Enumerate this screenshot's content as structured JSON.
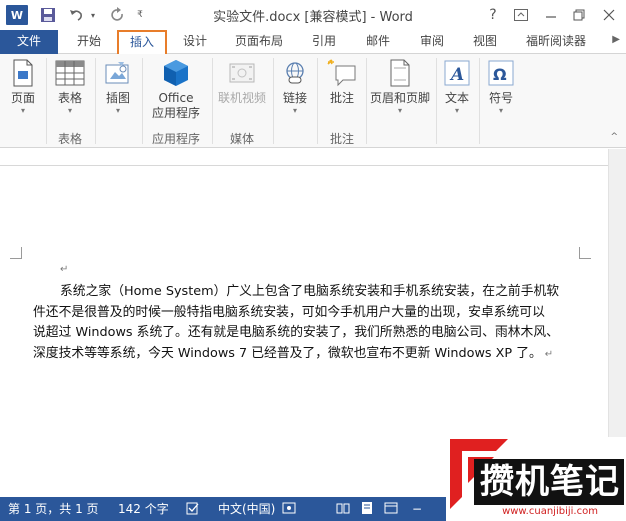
{
  "window": {
    "app_icon_letter": "W",
    "title": "实验文件.docx [兼容模式] - Word",
    "help_label": "?"
  },
  "tabs": [
    {
      "label": "文件"
    },
    {
      "label": "开始"
    },
    {
      "label": "插入"
    },
    {
      "label": "设计"
    },
    {
      "label": "页面布局"
    },
    {
      "label": "引用"
    },
    {
      "label": "邮件"
    },
    {
      "label": "审阅"
    },
    {
      "label": "视图"
    },
    {
      "label": "福昕阅读器"
    }
  ],
  "ribbon": {
    "page_label": "页面",
    "table_label": "表格",
    "illustrations_label": "插图",
    "office_line1": "Office",
    "office_line2": "应用程序",
    "online_video_label": "联机视频",
    "link_label": "链接",
    "comment_label": "批注",
    "header_footer_label": "页眉和页脚",
    "text_label": "文本",
    "symbol_label": "符号",
    "groups": {
      "tables": "表格",
      "apps": "应用程序",
      "media": "媒体",
      "comments": "批注"
    }
  },
  "document": {
    "lines": [
      "系统之家（Home System）广义上包含了电脑系统安装和手机系统安装，在之前手机软",
      "件还不是很普及的时候一般特指电脑系统安装，可如今手机用户大量的出现，安卓系统可以",
      "说超过 Windows 系统了。还有就是电脑系统的安装了，我们所熟悉的电脑公司、雨林木风、",
      "深度技术等等系统，今天 Windows 7 已经普及了，微软也宣布不更新 Windows XP 了。"
    ],
    "para_mark": "↵"
  },
  "status": {
    "page": "第 1 页，共 1 页",
    "words": "142 个字",
    "language": "中文(中国)"
  },
  "watermark": {
    "title": "攒机笔记",
    "url": "www.cuanjibiji.com"
  },
  "colors": {
    "word_blue": "#2b579a",
    "active_tab_outline": "#e87d2a",
    "watermark_red": "#e02020"
  }
}
